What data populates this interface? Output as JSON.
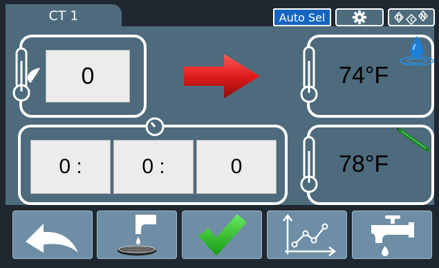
{
  "header": {
    "tab_title": "CT 1",
    "auto_sel_label": "Auto Sel",
    "gear_icon": "gear-icon",
    "dcn_icon": "d-c-n-logo-icon"
  },
  "setpoint": {
    "value": "0",
    "icon": "thermometer-leaf-icon"
  },
  "timer": {
    "hours": "0 :",
    "minutes": "0 :",
    "seconds": "0",
    "icon": "stopwatch-icon"
  },
  "readouts": {
    "water_temp": "74°F",
    "water_icon": "water-drop-icon",
    "probe_temp": "78°F",
    "probe_icon": "probe-icon"
  },
  "arrow": {
    "icon": "right-arrow-icon",
    "color": "#e01b1b"
  },
  "buttons": [
    {
      "name": "back-button",
      "icon": "back-arrow-icon"
    },
    {
      "name": "dispense-button",
      "icon": "faucet-drip-icon"
    },
    {
      "name": "confirm-button",
      "icon": "checkmark-icon"
    },
    {
      "name": "chart-button",
      "icon": "line-chart-icon"
    },
    {
      "name": "faucet-button",
      "icon": "faucet-icon"
    }
  ],
  "colors": {
    "panel": "#4d6b7c",
    "button": "#6d8ea4",
    "auto_sel": "#1565c0",
    "check": "#22c31d"
  }
}
